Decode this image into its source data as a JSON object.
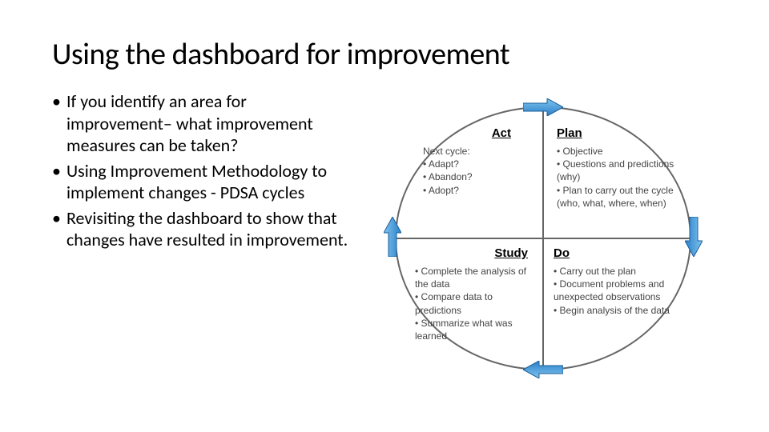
{
  "title": "Using the dashboard for improvement",
  "bullets": {
    "b1": "If you identify an area for improvement– what improvement measures can be taken?",
    "b2": "Using Improvement Methodology to implement changes  - PDSA cycles",
    "b3": "Revisiting the dashboard to show that changes have resulted in improvement."
  },
  "pdsa": {
    "act": {
      "title": "Act",
      "sub": "Next cycle:",
      "items": {
        "i1": "Adapt?",
        "i2": "Abandon?",
        "i3": "Adopt?"
      }
    },
    "plan": {
      "title": "Plan",
      "items": {
        "i1": "Objective",
        "i2": "Questions and predictions (why)",
        "i3": "Plan to carry out the cycle (who, what, where, when)"
      }
    },
    "study": {
      "title": "Study",
      "items": {
        "i1": "Complete the analysis of the data",
        "i2": "Compare data to predictions",
        "i3": "Summarize what was learned"
      }
    },
    "do": {
      "title": "Do",
      "items": {
        "i1": "Carry out the plan",
        "i2": "Document problems and unexpected observations",
        "i3": "Begin analysis of the data"
      }
    }
  }
}
